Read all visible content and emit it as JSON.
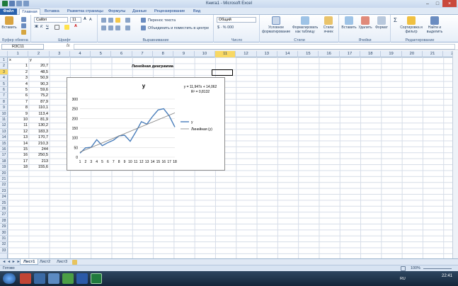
{
  "window": {
    "title": "Книга1 - Microsoft Excel"
  },
  "ribbon_tabs": [
    "Файл",
    "Главная",
    "Вставка",
    "Разметка страницы",
    "Формулы",
    "Данные",
    "Рецензирование",
    "Вид"
  ],
  "ribbon": {
    "paste": "Вставить",
    "clipboard": "Буфер обмена",
    "font_name": "Calibri",
    "font_size": "11",
    "font_group": "Шрифт",
    "wrap_text": "Перенос текста",
    "merge_center": "Объединить и поместить в центре",
    "align_group": "Выравнивание",
    "number_format": "Общий",
    "number_group": "Число",
    "cond_format": "Условное форматирование",
    "format_table": "Форматировать как таблицу",
    "cell_styles": "Стили ячеек",
    "styles_group": "Стили",
    "insert": "Вставить",
    "delete": "Удалить",
    "format": "Формат",
    "cells_group": "Ячейки",
    "sort_filter": "Сортировка и фильтр",
    "find_select": "Найти и выделить",
    "editing_group": "Редактирование"
  },
  "formula_bar": {
    "name_box": "R3C11",
    "fx": "fx",
    "value": ""
  },
  "columns": [
    "1",
    "2",
    "3",
    "4",
    "5",
    "6",
    "7",
    "8",
    "9",
    "10",
    "11",
    "12",
    "13",
    "14",
    "15",
    "16",
    "17",
    "18",
    "19",
    "20",
    "21",
    "22"
  ],
  "selected_column": "11",
  "rows": [
    "1",
    "2",
    "3",
    "4",
    "5",
    "6",
    "7",
    "8",
    "9",
    "10",
    "11",
    "12",
    "13",
    "14",
    "15",
    "16",
    "17",
    "18",
    "19",
    "20",
    "21",
    "22",
    "23",
    "24",
    "25",
    "26",
    "27",
    "28",
    "29",
    "30",
    "31",
    "32",
    "33"
  ],
  "selected_row": "3",
  "header_x": "x",
  "header_y": "y",
  "table": [
    {
      "x": "1",
      "y": "20,7"
    },
    {
      "x": "2",
      "y": "48,5"
    },
    {
      "x": "3",
      "y": "50,9"
    },
    {
      "x": "4",
      "y": "90,3"
    },
    {
      "x": "5",
      "y": "59,6"
    },
    {
      "x": "6",
      "y": "75,2"
    },
    {
      "x": "7",
      "y": "87,9"
    },
    {
      "x": "8",
      "y": "110,1"
    },
    {
      "x": "9",
      "y": "113,4"
    },
    {
      "x": "10",
      "y": "81,9"
    },
    {
      "x": "11",
      "y": "130,2"
    },
    {
      "x": "12",
      "y": "183,3"
    },
    {
      "x": "13",
      "y": "170,7"
    },
    {
      "x": "14",
      "y": "210,3"
    },
    {
      "x": "15",
      "y": "244"
    },
    {
      "x": "16",
      "y": "250,5"
    },
    {
      "x": "17",
      "y": "213"
    },
    {
      "x": "18",
      "y": "155,6"
    }
  ],
  "chart_caption": "Линейная диаграмма",
  "chart_data": {
    "type": "line",
    "title": "y",
    "x": [
      1,
      2,
      3,
      4,
      5,
      6,
      7,
      8,
      9,
      10,
      11,
      12,
      13,
      14,
      15,
      16,
      17,
      18
    ],
    "series": [
      {
        "name": "y",
        "values": [
          20.7,
          48.5,
          50.9,
          90.3,
          59.6,
          75.2,
          87.9,
          110.1,
          113.4,
          81.9,
          130.2,
          183.3,
          170.7,
          210.3,
          244,
          250.5,
          213,
          155.6
        ],
        "color": "#4a7ebb"
      },
      {
        "name": "Линейная (y)",
        "trend": {
          "slope": 11.947,
          "intercept": 14.062
        },
        "color": "#7f7f7f"
      }
    ],
    "yticks": [
      "0",
      "50",
      "100",
      "150",
      "200",
      "250",
      "300"
    ],
    "ylim": [
      0,
      300
    ],
    "xticks": [
      "1",
      "2",
      "3",
      "4",
      "5",
      "6",
      "7",
      "8",
      "9",
      "10",
      "11",
      "12",
      "13",
      "14",
      "15",
      "16",
      "17",
      "18"
    ],
    "equation": "y = 11,947x + 14,062",
    "r2": "R² = 0,8132",
    "legend": "right",
    "grid": true
  },
  "sheets": [
    "Лист1",
    "Лист2",
    "Лист3"
  ],
  "active_sheet": "Лист1",
  "status": {
    "ready": "Готово",
    "zoom": "100%"
  },
  "clock": {
    "lang": "RU",
    "time": "22:41"
  }
}
